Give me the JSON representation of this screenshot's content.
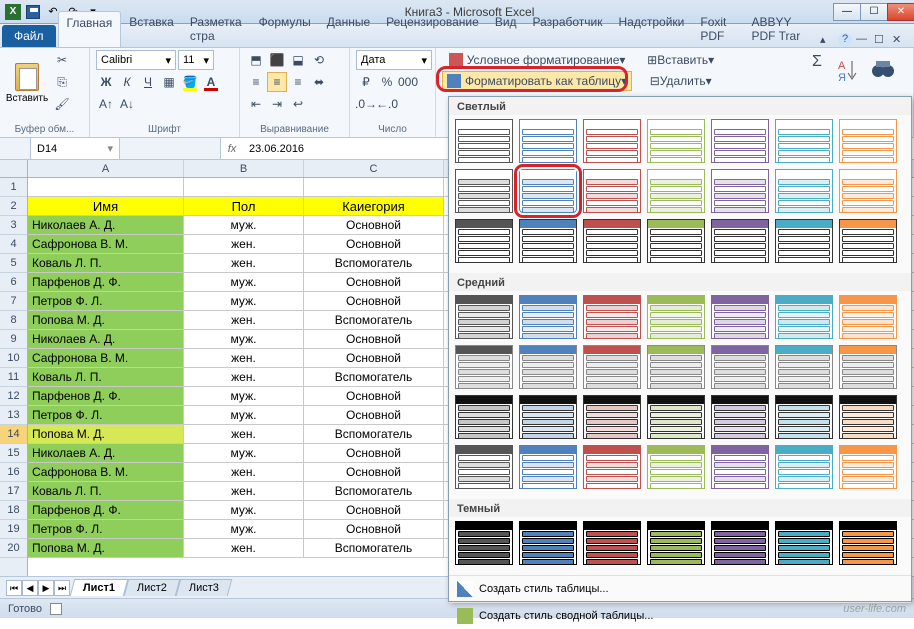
{
  "window": {
    "title": "Книга3 - Microsoft Excel"
  },
  "qat": [
    "excel",
    "save",
    "undo",
    "redo",
    "print",
    "more"
  ],
  "tabs": {
    "file": "Файл",
    "items": [
      "Главная",
      "Вставка",
      "Разметка стра",
      "Формулы",
      "Данные",
      "Рецензирование",
      "Вид",
      "Разработчик",
      "Надстройки",
      "Foxit PDF",
      "ABBYY PDF Trar"
    ],
    "active": 0
  },
  "ribbon": {
    "clipboard": {
      "paste": "Вставить",
      "label": "Буфер обм..."
    },
    "font": {
      "name": "Calibri",
      "size": "11",
      "label": "Шрифт"
    },
    "align": {
      "label": "Выравнивание"
    },
    "number": {
      "format": "Дата",
      "label": "Число"
    },
    "styles": {
      "cond": "Условное форматирование",
      "fmt_table": "Форматировать как таблицу"
    },
    "cells": {
      "insert": "Вставить",
      "delete": "Удалить"
    }
  },
  "namebox": "D14",
  "formula": "23.06.2016",
  "columns": [
    "A",
    "B",
    "C"
  ],
  "headers": [
    "Имя",
    "Пол",
    "Каиегория"
  ],
  "rows": [
    {
      "n": 3,
      "a": "Николаев А. Д.",
      "b": "муж.",
      "c": "Основной"
    },
    {
      "n": 4,
      "a": "Сафронова В. М.",
      "b": "жен.",
      "c": "Основной"
    },
    {
      "n": 5,
      "a": "Коваль Л. П.",
      "b": "жен.",
      "c": "Вспомогатель"
    },
    {
      "n": 6,
      "a": "Парфенов Д. Ф.",
      "b": "муж.",
      "c": "Основной"
    },
    {
      "n": 7,
      "a": "Петров Ф. Л.",
      "b": "муж.",
      "c": "Основной"
    },
    {
      "n": 8,
      "a": "Попова М. Д.",
      "b": "жен.",
      "c": "Вспомогатель"
    },
    {
      "n": 9,
      "a": "Николаев А. Д.",
      "b": "муж.",
      "c": "Основной"
    },
    {
      "n": 10,
      "a": "Сафронова В. М.",
      "b": "жен.",
      "c": "Основной"
    },
    {
      "n": 11,
      "a": "Коваль Л. П.",
      "b": "жен.",
      "c": "Вспомогатель"
    },
    {
      "n": 12,
      "a": "Парфенов Д. Ф.",
      "b": "муж.",
      "c": "Основной"
    },
    {
      "n": 13,
      "a": "Петров Ф. Л.",
      "b": "муж.",
      "c": "Основной"
    },
    {
      "n": 14,
      "a": "Попова М. Д.",
      "b": "жен.",
      "c": "Вспомогатель",
      "sel": true
    },
    {
      "n": 15,
      "a": "Николаев А. Д.",
      "b": "муж.",
      "c": "Основной"
    },
    {
      "n": 16,
      "a": "Сафронова В. М.",
      "b": "жен.",
      "c": "Основной"
    },
    {
      "n": 17,
      "a": "Коваль Л. П.",
      "b": "жен.",
      "c": "Вспомогатель"
    },
    {
      "n": 18,
      "a": "Парфенов Д. Ф.",
      "b": "муж.",
      "c": "Основной"
    },
    {
      "n": 19,
      "a": "Петров Ф. Л.",
      "b": "муж.",
      "c": "Основной"
    },
    {
      "n": 20,
      "a": "Попова М. Д.",
      "b": "жен.",
      "c": "Вспомогатель"
    }
  ],
  "sheets": {
    "items": [
      "Лист1",
      "Лист2",
      "Лист3"
    ],
    "active": 0
  },
  "status": "Готово",
  "watermark": "user-life.com",
  "gallery": {
    "light": "Светлый",
    "medium": "Средний",
    "dark": "Темный",
    "new_style": "Создать стиль таблицы...",
    "new_pivot": "Создать стиль сводной таблицы...",
    "palette": [
      "#555555",
      "#4f81bd",
      "#c0504d",
      "#9bbb59",
      "#8064a2",
      "#4bacc6",
      "#f79646"
    ]
  }
}
